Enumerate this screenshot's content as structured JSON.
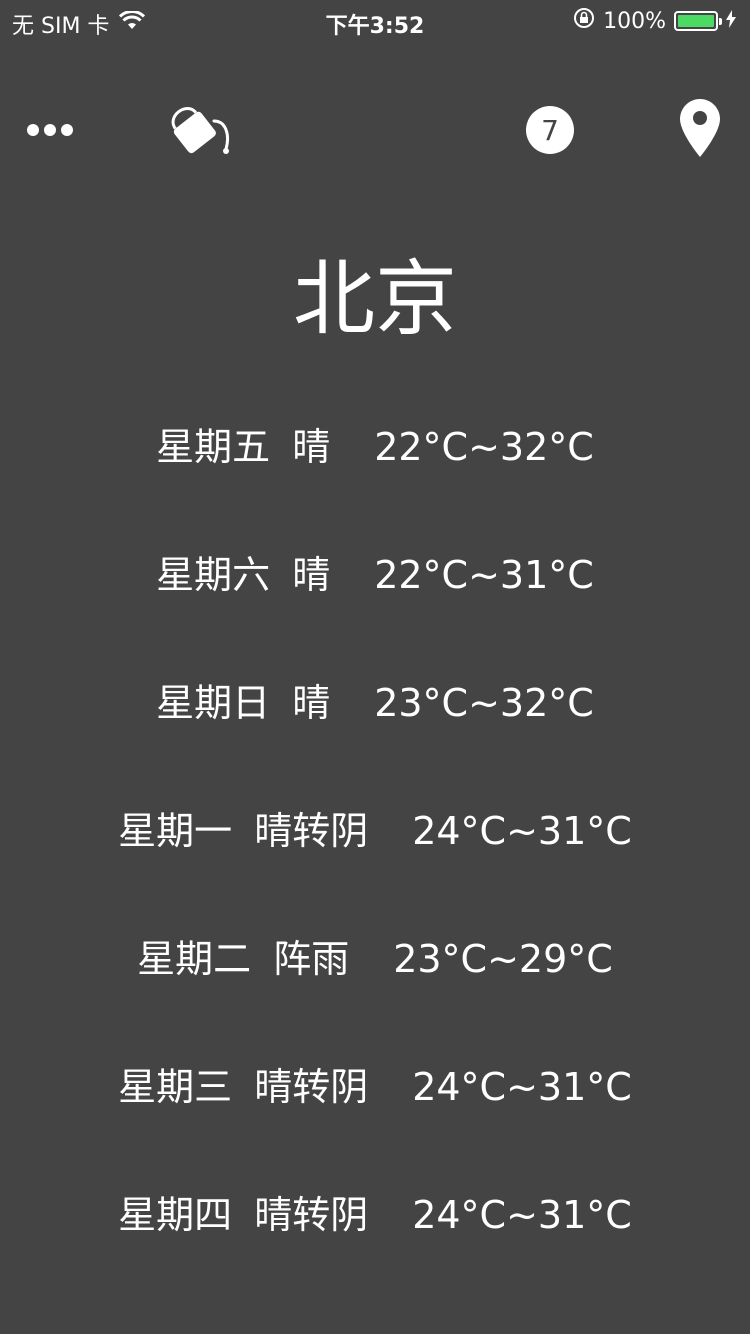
{
  "status_bar": {
    "carrier": "无 SIM 卡",
    "time": "下午3:52",
    "battery_pct": "100%",
    "battery_level": 1.0,
    "battery_color": "#4cd964"
  },
  "toolbar": {
    "more_icon": "more-dots-icon",
    "paint_icon": "paint-bucket-icon",
    "days_count": "7",
    "location_icon": "location-pin-icon"
  },
  "city": "北京",
  "forecast": [
    {
      "day": "星期五",
      "condition": "晴",
      "temp": "22°C~32°C"
    },
    {
      "day": "星期六",
      "condition": "晴",
      "temp": "22°C~31°C"
    },
    {
      "day": "星期日",
      "condition": "晴",
      "temp": "23°C~32°C"
    },
    {
      "day": "星期一",
      "condition": "晴转阴",
      "temp": "24°C~31°C"
    },
    {
      "day": "星期二",
      "condition": "阵雨",
      "temp": "23°C~29°C"
    },
    {
      "day": "星期三",
      "condition": "晴转阴",
      "temp": "24°C~31°C"
    },
    {
      "day": "星期四",
      "condition": "晴转阴",
      "temp": "24°C~31°C"
    }
  ],
  "colors": {
    "background": "#444444",
    "text": "#ffffff"
  }
}
